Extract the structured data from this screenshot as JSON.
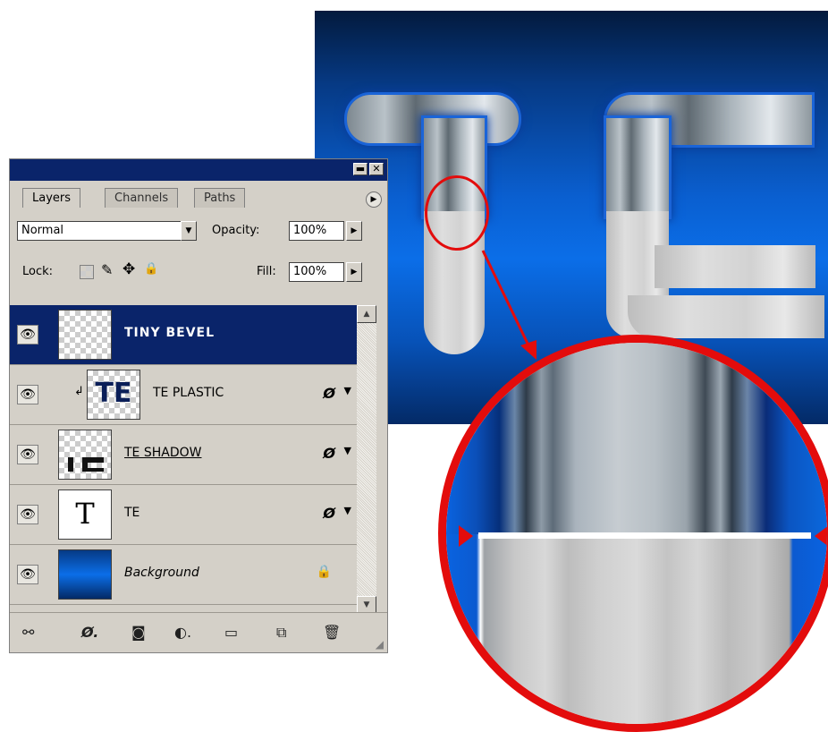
{
  "artwork": {
    "text": "TE"
  },
  "palette": {
    "tabs": [
      {
        "label": "Layers",
        "active": true
      },
      {
        "label": "Channels",
        "active": false
      },
      {
        "label": "Paths",
        "active": false
      }
    ],
    "blend_mode": "Normal",
    "opacity_label": "Opacity:",
    "opacity_value": "100%",
    "lock_label": "Lock:",
    "fill_label": "Fill:",
    "fill_value": "100%",
    "layers": [
      {
        "name": "TINY BEVEL",
        "selected": true,
        "thumb": "transparent"
      },
      {
        "name": "TE PLASTIC",
        "selected": false,
        "thumb": "TE",
        "clipped": true,
        "fx": true
      },
      {
        "name": "TE SHADOW",
        "selected": false,
        "thumb": "transparent-shadow",
        "fx": true
      },
      {
        "name": "TE",
        "selected": false,
        "thumb": "T",
        "fx": true
      },
      {
        "name": "Background",
        "selected": false,
        "thumb": "blue-gradient",
        "locked": true
      }
    ]
  },
  "colors": {
    "selection": "#0a246a",
    "callout": "#e30c0c",
    "panel": "#d4d0c8"
  }
}
